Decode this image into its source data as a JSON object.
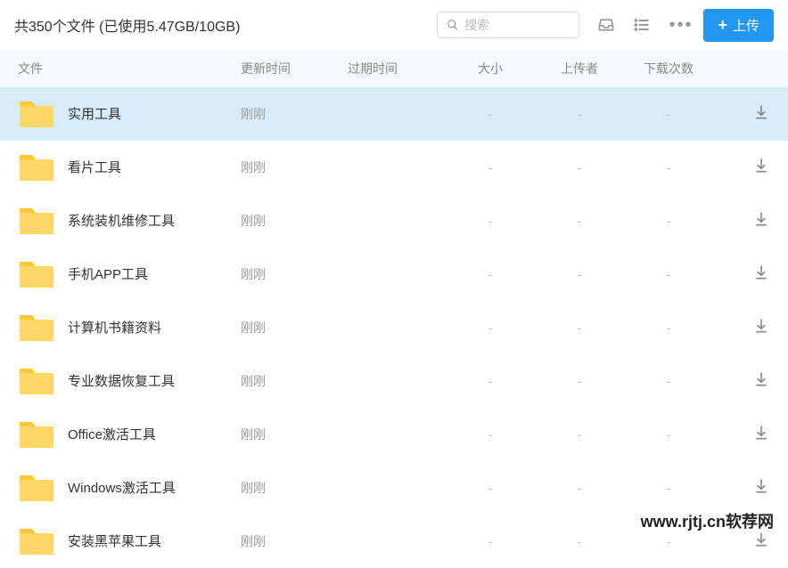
{
  "toolbar": {
    "summary": "共350个文件 (已使用5.47GB/10GB)",
    "search_placeholder": "搜索",
    "upload_label": "上传"
  },
  "columns": {
    "file": "文件",
    "update": "更新时间",
    "expire": "过期时间",
    "size": "大小",
    "uploader": "上传者",
    "downloads": "下载次数"
  },
  "files": [
    {
      "name": "实用工具",
      "update": "刚刚",
      "expire": "",
      "size": "-",
      "uploader": "-",
      "downloads": "-",
      "selected": true
    },
    {
      "name": "看片工具",
      "update": "刚刚",
      "expire": "",
      "size": "-",
      "uploader": "-",
      "downloads": "-",
      "selected": false
    },
    {
      "name": "系统装机维修工具",
      "update": "刚刚",
      "expire": "",
      "size": "-",
      "uploader": "-",
      "downloads": "-",
      "selected": false
    },
    {
      "name": "手机APP工具",
      "update": "刚刚",
      "expire": "",
      "size": "-",
      "uploader": "-",
      "downloads": "-",
      "selected": false
    },
    {
      "name": "计算机书籍资料",
      "update": "刚刚",
      "expire": "",
      "size": "-",
      "uploader": "-",
      "downloads": "-",
      "selected": false
    },
    {
      "name": "专业数据恢复工具",
      "update": "刚刚",
      "expire": "",
      "size": "-",
      "uploader": "-",
      "downloads": "-",
      "selected": false
    },
    {
      "name": "Office激活工具",
      "update": "刚刚",
      "expire": "",
      "size": "-",
      "uploader": "-",
      "downloads": "-",
      "selected": false
    },
    {
      "name": "Windows激活工具",
      "update": "刚刚",
      "expire": "",
      "size": "-",
      "uploader": "-",
      "downloads": "-",
      "selected": false
    },
    {
      "name": "安装黑苹果工具",
      "update": "刚刚",
      "expire": "",
      "size": "-",
      "uploader": "-",
      "downloads": "-",
      "selected": false
    }
  ],
  "watermark": "www.rjtj.cn软荐网"
}
